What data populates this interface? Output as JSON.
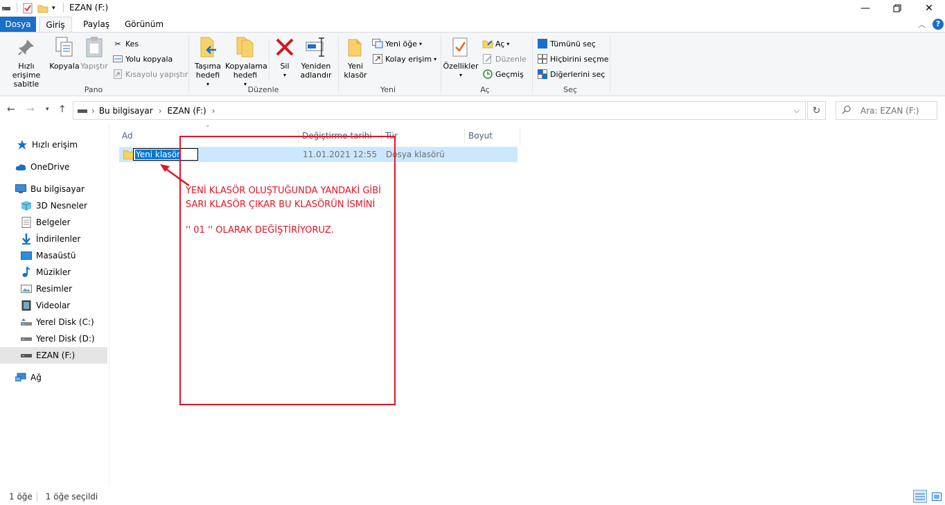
{
  "window": {
    "title": "EZAN (F:)"
  },
  "ribbon_tabs": [
    "Dosya",
    "Giriş",
    "Paylaş",
    "Görünüm"
  ],
  "ribbon": {
    "pano": {
      "label": "Pano",
      "pin": "Hızlı erişime sabitle",
      "copy": "Kopyala",
      "paste": "Yapıştır",
      "cut": "Kes",
      "copy_path": "Yolu kopyala",
      "paste_shortcut": "Kısayolu yapıştır"
    },
    "duzenle": {
      "label": "Düzenle",
      "move_to": "Taşıma hedefi",
      "copy_to": "Kopyalama hedefi",
      "delete": "Sil",
      "rename": "Yeniden adlandır"
    },
    "yeni": {
      "label": "Yeni",
      "new_folder": "Yeni klasör",
      "new_item": "Yeni öğe",
      "easy_access": "Kolay erişim"
    },
    "ac": {
      "label": "Aç",
      "properties": "Özellikler",
      "open": "Aç",
      "edit": "Düzenle",
      "history": "Geçmiş"
    },
    "sec": {
      "label": "Seç",
      "select_all": "Tümünü seç",
      "select_none": "Hiçbirini seçme",
      "invert": "Diğerlerini seç"
    }
  },
  "address": {
    "crumbs": [
      "Bu bilgisayar",
      "EZAN (F:)"
    ],
    "search_placeholder": "Ara: EZAN (F:)"
  },
  "sidebar": {
    "items": [
      {
        "label": "Hızlı erişim",
        "icon": "star-icon"
      },
      {
        "label": "OneDrive",
        "icon": "cloud-icon"
      },
      {
        "label": "Bu bilgisayar",
        "icon": "computer-icon"
      },
      {
        "label": "3D Nesneler",
        "icon": "cube-icon"
      },
      {
        "label": "Belgeler",
        "icon": "document-icon"
      },
      {
        "label": "İndirilenler",
        "icon": "download-icon"
      },
      {
        "label": "Masaüstü",
        "icon": "desktop-icon"
      },
      {
        "label": "Müzikler",
        "icon": "music-icon"
      },
      {
        "label": "Resimler",
        "icon": "picture-icon"
      },
      {
        "label": "Videolar",
        "icon": "video-icon"
      },
      {
        "label": "Yerel Disk (C:)",
        "icon": "drive-icon"
      },
      {
        "label": "Yerel Disk (D:)",
        "icon": "drive-icon"
      },
      {
        "label": "EZAN (F:)",
        "icon": "usb-drive-icon"
      },
      {
        "label": "Ağ",
        "icon": "network-icon"
      }
    ]
  },
  "columns": [
    "Ad",
    "Değiştirme tarihi",
    "Tür",
    "Boyut"
  ],
  "files": [
    {
      "name": "Yeni klasör",
      "modified": "11.01.2021 12:55",
      "type": "Dosya klasörü",
      "size": ""
    }
  ],
  "annotation": {
    "line1": "YENİ KLASÖR OLUŞTUĞUNDA YANDAKİ GİBİ",
    "line2": "SARI KLASÖR ÇIKAR BU KLASÖRÜN İSMİNİ",
    "line3": "'' 01 '' OLARAK DEĞİŞTİRİYORUZ.",
    "color": "#e81123"
  },
  "status": {
    "count": "1 öğe",
    "selected": "1 öğe seçildi"
  },
  "colors": {
    "accent": "#1a6fc9",
    "selection": "#cce8ff",
    "folder": "#f7d26a"
  }
}
